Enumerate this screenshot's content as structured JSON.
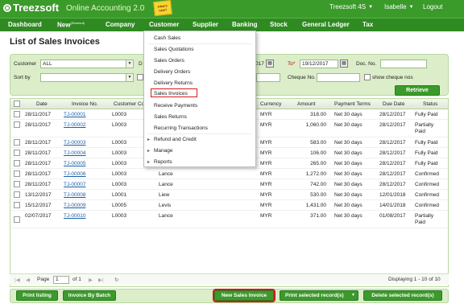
{
  "brand": {
    "logo": "Treezsoft",
    "product": "Online Accounting 2.0",
    "badge": "what's new?"
  },
  "user": {
    "company": "Treezsoft 4S",
    "name": "Isabelle",
    "logout": "Logout"
  },
  "nav": {
    "dashboard": "Dashboard",
    "new": "New",
    "new_sup": "(Shortcut)",
    "company": "Company",
    "customer": "Customer",
    "supplier": "Supplier",
    "banking": "Banking",
    "stock": "Stock",
    "general_ledger": "General Ledger",
    "tax": "Tax"
  },
  "page_title": "List of Sales Invoices",
  "filters": {
    "customer_label": "Customer",
    "customer_value": "ALL",
    "d_label": "D",
    "from_date_tail": "017",
    "to_label": "To*",
    "to_value": "19/12/2017",
    "docno_label": "Doc. No.",
    "docno_value": "",
    "sortby_label": "Sort by",
    "sortby_value": "",
    "chequeno_label": "Cheque No.",
    "chequeno_value": "",
    "show_cheque_label": "show cheque nos",
    "retrieve": "Retrieve"
  },
  "columns": {
    "date": "Date",
    "invoice_no": "Invoice No.",
    "customer_code": "Customer Co",
    "currency": "Currency",
    "amount": "Amount",
    "payment_terms": "Payment Terms",
    "due_date": "Due Date",
    "status": "Status"
  },
  "rows": [
    {
      "date": "28/11/2017",
      "invoice": "TJ-00001",
      "code": "L0003",
      "name": "",
      "currency": "MYR",
      "amount": "318.00",
      "terms": "Net 30 days",
      "due": "28/12/2017",
      "status": "Fully Paid",
      "status2": ""
    },
    {
      "date": "28/11/2017",
      "invoice": "TJ-00002",
      "code": "L0003",
      "name": "",
      "currency": "MYR",
      "amount": "1,060.00",
      "terms": "Net 30 days",
      "due": "28/12/2017",
      "status": "Partially",
      "status2": "Paid"
    },
    {
      "date": "28/11/2017",
      "invoice": "TJ-00003",
      "code": "L0003",
      "name": "",
      "currency": "MYR",
      "amount": "583.00",
      "terms": "Net 30 days",
      "due": "28/12/2017",
      "status": "Fully Paid",
      "status2": ""
    },
    {
      "date": "28/11/2017",
      "invoice": "TJ-00004",
      "code": "L0003",
      "name": "",
      "currency": "MYR",
      "amount": "106.00",
      "terms": "Net 30 days",
      "due": "28/12/2017",
      "status": "Fully Paid",
      "status2": ""
    },
    {
      "date": "28/11/2017",
      "invoice": "TJ-00005",
      "code": "L0003",
      "name": "",
      "currency": "MYR",
      "amount": "265.00",
      "terms": "Net 30 days",
      "due": "28/12/2017",
      "status": "Fully Paid",
      "status2": ""
    },
    {
      "date": "28/11/2017",
      "invoice": "TJ-00006",
      "code": "L0003",
      "name": "Lance",
      "currency": "MYR",
      "amount": "1,272.00",
      "terms": "Net 30 days",
      "due": "28/12/2017",
      "status": "Confirmed",
      "status2": ""
    },
    {
      "date": "28/11/2017",
      "invoice": "TJ-00007",
      "code": "L0003",
      "name": "Lance",
      "currency": "MYR",
      "amount": "742.00",
      "terms": "Net 30 days",
      "due": "28/12/2017",
      "status": "Confirmed",
      "status2": ""
    },
    {
      "date": "13/12/2017",
      "invoice": "TJ-00008",
      "code": "L0001",
      "name": "Liew",
      "currency": "MYR",
      "amount": "530.00",
      "terms": "Net 30 days",
      "due": "12/01/2018",
      "status": "Confirmed",
      "status2": ""
    },
    {
      "date": "15/12/2017",
      "invoice": "TJ-00009",
      "code": "L0005",
      "name": "Levis",
      "currency": "MYR",
      "amount": "1,431.00",
      "terms": "Net 30 days",
      "due": "14/01/2018",
      "status": "Confirmed",
      "status2": ""
    },
    {
      "date": "02/07/2017",
      "invoice": "TJ-00010",
      "code": "L0003",
      "name": "Lance",
      "currency": "MYR",
      "amount": "371.00",
      "terms": "Net 30 days",
      "due": "01/08/2017",
      "status": "Partially",
      "status2": "Paid"
    }
  ],
  "pager": {
    "page_label": "Page",
    "page_value": "1",
    "of_label": "of 1",
    "display_text": "Displaying 1 - 10 of 10"
  },
  "buttons": {
    "print_listing": "Print listing",
    "invoice_by_batch": "Invoice By Batch",
    "new_sales_invoice": "New Sales Invoice",
    "print_selected": "Print selected record(s)",
    "delete_selected": "Delete selected record(s)"
  },
  "customer_menu": {
    "items": [
      "Cash Sales",
      "Sales Quotations",
      "Sales Orders",
      "Delivery Orders",
      "Delivery Returns",
      "Sales Invoices",
      "Receive Payments",
      "Sales Returns",
      "Recurring Transactions",
      "Refund and Credit",
      "Manage",
      "Reports"
    ],
    "selected": "Sales Invoices"
  },
  "colors": {
    "brand_green": "#3a9b2a",
    "nav_green": "#2f8a21",
    "panel_green": "#dbeec9",
    "highlight_red": "#d01c1c",
    "link_blue": "#1b5fa8"
  }
}
